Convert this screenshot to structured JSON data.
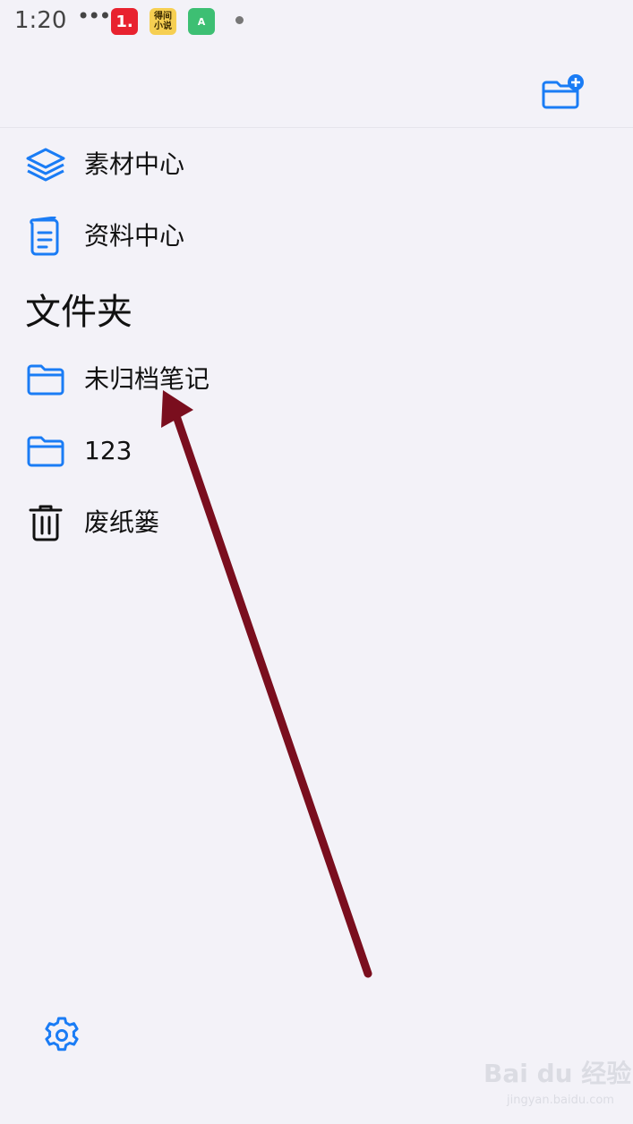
{
  "status_bar": {
    "time": "1:20",
    "more": "•••",
    "app_badges": [
      "1.",
      "得间\n小说",
      "A"
    ]
  },
  "header": {
    "new_folder_icon": "folder-plus-icon"
  },
  "sidebar": {
    "items": [
      {
        "label": "素材中心",
        "icon": "layers-icon"
      },
      {
        "label": "资料中心",
        "icon": "document-icon"
      }
    ],
    "section_title": "文件夹",
    "folders": [
      {
        "label": "未归档笔记",
        "icon": "folder-icon"
      },
      {
        "label": "123",
        "icon": "folder-icon"
      },
      {
        "label": "废纸篓",
        "icon": "trash-icon"
      }
    ],
    "settings_icon": "gear-icon"
  },
  "colors": {
    "accent": "#1a7cf5",
    "background": "#f3f2f8",
    "annotation_arrow": "#7a0e1e"
  },
  "watermark": {
    "brand": "Bai du 经验",
    "url": "jingyan.baidu.com"
  }
}
